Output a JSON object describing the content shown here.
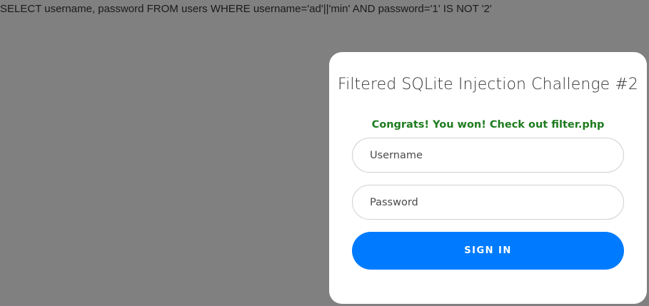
{
  "query": {
    "text": "SELECT username, password FROM users WHERE username='ad'||'min' AND password='1' IS NOT '2'"
  },
  "login_card": {
    "title": "Filtered SQLite Injection Challenge #2",
    "status_message": "Congrats! You won! Check out filter.php",
    "username_placeholder": "Username",
    "password_placeholder": "Password",
    "signin_label": "SIGN IN"
  },
  "colors": {
    "background": "#808080",
    "card": "#ffffff",
    "success_text": "#1e7b1e",
    "primary_button": "#007bff"
  }
}
